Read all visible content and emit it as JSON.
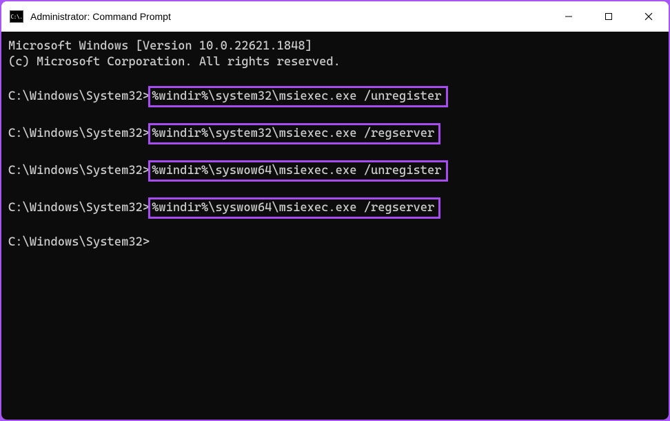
{
  "window": {
    "icon_label": "C:\\.",
    "title": "Administrator: Command Prompt"
  },
  "terminal": {
    "header_line1": "Microsoft Windows [Version 10.0.22621.1848]",
    "header_line2": "(c) Microsoft Corporation. All rights reserved.",
    "prompt": "C:\\Windows\\System32>",
    "commands": [
      "%windir%\\system32\\msiexec.exe /unregister",
      "%windir%\\system32\\msiexec.exe /regserver",
      "%windir%\\syswow64\\msiexec.exe /unregister",
      "%windir%\\syswow64\\msiexec.exe /regserver"
    ],
    "final_prompt": "C:\\Windows\\System32>"
  },
  "highlight_color": "#a64cf0"
}
